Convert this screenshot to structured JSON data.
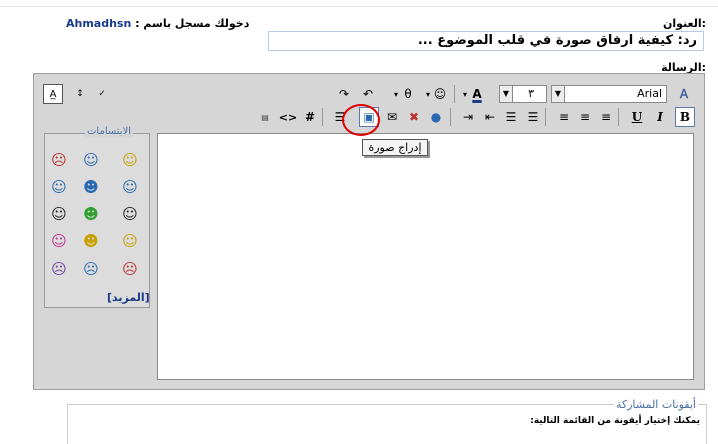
{
  "header": {
    "title_label": "العنوان:",
    "login_text": "دخولك مسجل باسم :",
    "username": "Ahmadhsn",
    "title_value": "رد: كيفية ارفاق صورة في قلب الموضوع ...",
    "message_label": "الرسالة:"
  },
  "toolbar": {
    "font_name": "Arial",
    "font_size": "٣",
    "tooltip": "إدراج صورة"
  },
  "smilies": {
    "title": "الابتسامات",
    "more": "[المزيد]"
  },
  "post_icons": {
    "title": "أيقونات المشاركة",
    "text": "يمكنك إختيار أيقونة من القائمة التالية:"
  }
}
